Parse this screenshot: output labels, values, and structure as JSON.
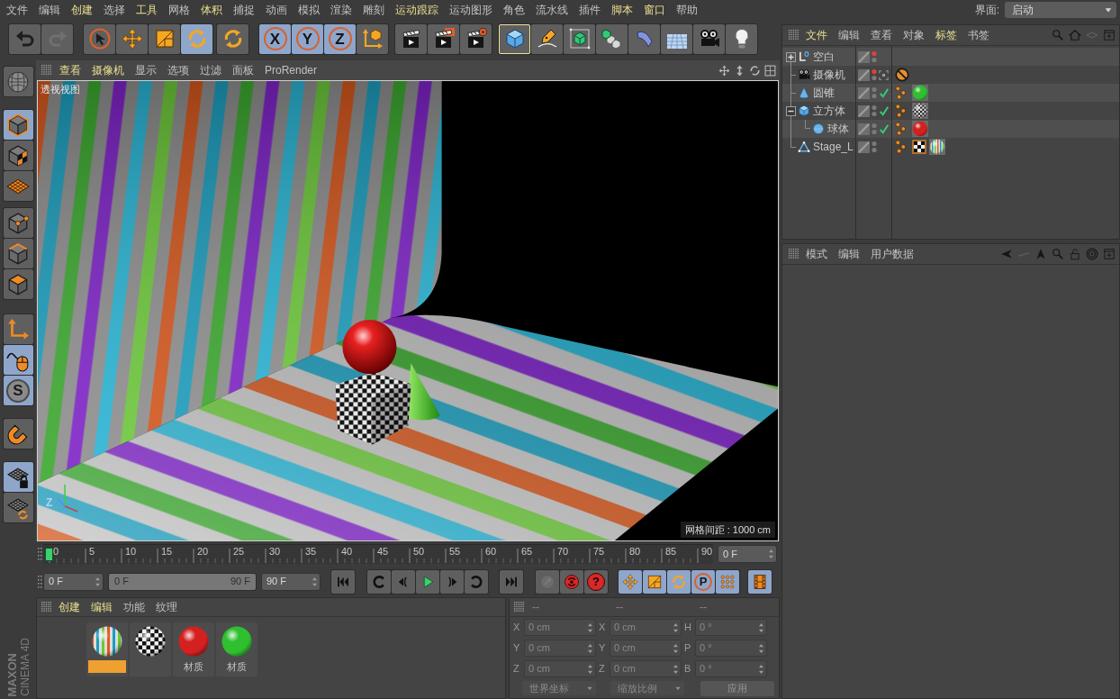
{
  "menu_bar": {
    "items": [
      {
        "label": "文件",
        "highlight": false
      },
      {
        "label": "编辑",
        "highlight": false
      },
      {
        "label": "创建",
        "highlight": true
      },
      {
        "label": "选择",
        "highlight": false
      },
      {
        "label": "工具",
        "highlight": true
      },
      {
        "label": "网格",
        "highlight": false
      },
      {
        "label": "体积",
        "highlight": true
      },
      {
        "label": "捕捉",
        "highlight": false
      },
      {
        "label": "动画",
        "highlight": false
      },
      {
        "label": "模拟",
        "highlight": false
      },
      {
        "label": "渲染",
        "highlight": false
      },
      {
        "label": "雕刻",
        "highlight": false
      },
      {
        "label": "运动跟踪",
        "highlight": true
      },
      {
        "label": "运动图形",
        "highlight": false
      },
      {
        "label": "角色",
        "highlight": false
      },
      {
        "label": "流水线",
        "highlight": false
      },
      {
        "label": "插件",
        "highlight": false
      },
      {
        "label": "脚本",
        "highlight": true
      },
      {
        "label": "窗口",
        "highlight": true
      },
      {
        "label": "帮助",
        "highlight": false
      }
    ],
    "layout_label": "界面:",
    "layout_value": "启动"
  },
  "toolbar": {
    "groups": [
      {
        "buttons": [
          {
            "selected": false,
            "disabled": false
          },
          {
            "selected": false,
            "disabled": true
          }
        ]
      },
      {
        "buttons": [
          {
            "selected": false,
            "disabled": false
          },
          {
            "selected": false,
            "disabled": false
          },
          {
            "selected": false,
            "disabled": false
          },
          {
            "selected": true,
            "disabled": false
          }
        ]
      },
      {
        "buttons": [
          {
            "selected": false,
            "disabled": false
          }
        ]
      },
      {
        "buttons": [
          {
            "label": "X",
            "selected": true,
            "disabled": false
          },
          {
            "label": "Y",
            "selected": true,
            "disabled": false
          },
          {
            "label": "Z",
            "selected": true,
            "disabled": false
          },
          {
            "selected": false,
            "disabled": false
          }
        ]
      },
      {
        "buttons": [
          {
            "selected": false,
            "disabled": false
          },
          {
            "selected": false,
            "disabled": false
          },
          {
            "selected": false,
            "disabled": false
          }
        ]
      },
      {
        "buttons": [
          {
            "selected": false,
            "disabled": false,
            "highlighted": true
          },
          {
            "selected": false,
            "disabled": false,
            "highlighted": false
          },
          {
            "selected": false,
            "disabled": false,
            "highlighted": false
          },
          {
            "selected": false,
            "disabled": false,
            "highlighted": false
          },
          {
            "selected": false,
            "disabled": false,
            "highlighted": false
          },
          {
            "selected": false,
            "disabled": false,
            "highlighted": false
          },
          {
            "selected": false,
            "disabled": false,
            "highlighted": false
          },
          {
            "selected": false,
            "disabled": false,
            "highlighted": false
          }
        ]
      }
    ]
  },
  "left_tools": {
    "groups": [
      {
        "tools": [
          {
            "selected": false
          }
        ]
      },
      {
        "tools": [
          {
            "selected": true
          },
          {
            "selected": false
          },
          {
            "selected": false
          }
        ]
      },
      {
        "tools": [
          {
            "selected": false
          },
          {
            "selected": false
          },
          {
            "selected": false
          }
        ]
      },
      {
        "tools": [
          {
            "selected": false
          },
          {
            "selected": true
          },
          {
            "label": "S",
            "selected": true
          }
        ]
      },
      {
        "tools": [
          {
            "selected": false
          }
        ]
      },
      {
        "tools": [
          {
            "selected": true
          },
          {
            "selected": false
          }
        ]
      }
    ]
  },
  "logo": {
    "brand": "MAXON",
    "product": "CINEMA 4D"
  },
  "viewport": {
    "menu": [
      {
        "label": "查看",
        "highlight": true
      },
      {
        "label": "摄像机",
        "highlight": true
      },
      {
        "label": "显示",
        "highlight": false
      },
      {
        "label": "选项",
        "highlight": false
      },
      {
        "label": "过滤",
        "highlight": false
      },
      {
        "label": "面板",
        "highlight": false
      },
      {
        "label": "ProRender",
        "highlight": false
      }
    ],
    "view_name": "透视视图",
    "axis_label": "Z",
    "grid_spacing": "网格间距 : 1000 cm"
  },
  "timeline": {
    "ticks": [
      "0",
      "5",
      "10",
      "15",
      "20",
      "25",
      "30",
      "35",
      "40",
      "45",
      "50",
      "55",
      "60",
      "65",
      "70",
      "75",
      "80",
      "85",
      "90"
    ],
    "playhead": {
      "level": 0
    },
    "current_frame": "0 F"
  },
  "transport": {
    "start_frame": "0 F",
    "range": {
      "start": "0 F",
      "end": "90 F",
      "level": 1
    },
    "end_frame": "90 F",
    "record_buttons": [
      {
        "disabled": true
      },
      {
        "disabled": false
      },
      {
        "label": "?",
        "disabled": false
      }
    ],
    "key_buttons": [
      {
        "selected": true
      },
      {
        "selected": true
      },
      {
        "selected": true
      },
      {
        "label": "P",
        "selected": true
      },
      {
        "selected": true
      }
    ],
    "timeline_button": {
      "selected": true
    }
  },
  "materials": {
    "menu": [
      {
        "label": "创建",
        "highlight": true
      },
      {
        "label": "编辑",
        "highlight": true
      },
      {
        "label": "功能",
        "highlight": false
      },
      {
        "label": "纹理",
        "highlight": false
      }
    ],
    "items": [
      {
        "kind": "striped",
        "selected": true
      },
      {
        "kind": "checker",
        "selected": false
      },
      {
        "kind": "plain",
        "color": "#d42020",
        "label": "材质",
        "selected": false
      },
      {
        "kind": "plain",
        "color": "#2fbf2f",
        "label": "材质",
        "selected": false
      }
    ]
  },
  "coordinates": {
    "disabled": true,
    "headers": [
      "--",
      "--",
      "--"
    ],
    "rows": [
      [
        {
          "axis": "X",
          "value": "0 cm"
        },
        {
          "axis": "X",
          "value": "0 cm"
        },
        {
          "axis": "H",
          "value": "0 °"
        }
      ],
      [
        {
          "axis": "Y",
          "value": "0 cm"
        },
        {
          "axis": "Y",
          "value": "0 cm"
        },
        {
          "axis": "P",
          "value": "0 °"
        }
      ],
      [
        {
          "axis": "Z",
          "value": "0 cm"
        },
        {
          "axis": "Z",
          "value": "0 cm"
        },
        {
          "axis": "B",
          "value": "0 °"
        }
      ]
    ],
    "dropdowns": [
      "世界坐标",
      "缩放比例"
    ],
    "apply_label": "应用"
  },
  "object_manager": {
    "menu": [
      {
        "label": "文件",
        "highlight": true
      },
      {
        "label": "编辑",
        "highlight": false
      },
      {
        "label": "查看",
        "highlight": false
      },
      {
        "label": "对象",
        "highlight": false
      },
      {
        "label": "标签",
        "highlight": true
      },
      {
        "label": "书签",
        "highlight": false
      }
    ],
    "objects": [
      {
        "name": "空白",
        "kind": "null",
        "expanded": false,
        "editor_visible": false,
        "enabled_check": false
      },
      {
        "name": "摄像机",
        "kind": "camera",
        "editor_visible": false,
        "enabled_check": false,
        "tags": [
          {
            "kind": "protection"
          }
        ]
      },
      {
        "name": "圆锥",
        "kind": "cone",
        "editor_visible": true,
        "enabled_check": true,
        "tags": [
          {
            "kind": "phong"
          },
          {
            "kind": "material",
            "color": "#2fbf2f"
          }
        ]
      },
      {
        "name": "立方体",
        "kind": "cube",
        "expanded": true,
        "editor_visible": true,
        "enabled_check": true,
        "tags": [
          {
            "kind": "phong"
          },
          {
            "kind": "checker-material"
          }
        ],
        "children": [
          {
            "name": "球体",
            "kind": "sphere",
            "editor_visible": true,
            "enabled_check": true,
            "tags": [
              {
                "kind": "phong"
              },
              {
                "kind": "material",
                "color": "#d42020"
              }
            ]
          }
        ]
      },
      {
        "name": "Stage_L",
        "kind": "stage",
        "editor_visible": true,
        "enabled_check": false,
        "tags": [
          {
            "kind": "phong"
          },
          {
            "kind": "checker-texture"
          },
          {
            "kind": "striped-material"
          }
        ]
      }
    ]
  },
  "attributes": {
    "menu": [
      {
        "label": "模式",
        "highlight": false
      },
      {
        "label": "编辑",
        "highlight": false
      },
      {
        "label": "用户数据",
        "highlight": false
      }
    ]
  }
}
